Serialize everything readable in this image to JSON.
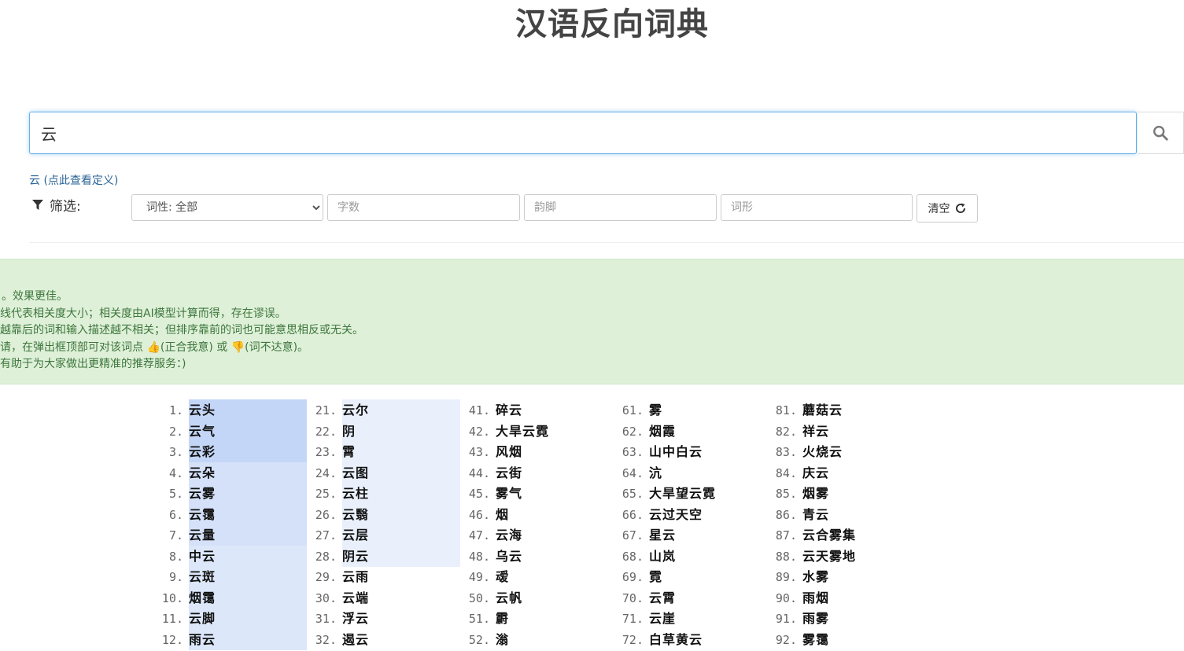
{
  "header": {
    "title": "汉语反向词典"
  },
  "search": {
    "value": "云"
  },
  "definition_link": "云 (点此查看定义)",
  "filters": {
    "label": "筛选:",
    "pos_select": "词性: 全部",
    "char_count_placeholder": "字数",
    "rhyme_placeholder": "韵脚",
    "shape_placeholder": "词形",
    "clear_label": "清空"
  },
  "notice": {
    "lines": [
      "。效果更佳。",
      "线代表相关度大小；相关度由AI模型计算而得，存在谬误。",
      "越靠后的词和输入描述越不相关；但排序靠前的词也可能意思相反或无关。",
      "请，在弹出框顶部可对该词点 👍(正合我意) 或 👎(词不达意)。",
      "有助于为大家做出更精准的推荐服务：)"
    ]
  },
  "colors": {
    "highlight_strong": "#c3d6f7",
    "highlight_mid": "#dce7fa",
    "highlight_light": "#e9f0fc"
  },
  "results": [
    {
      "n": "1.",
      "w": "云头",
      "rel": 1.0
    },
    {
      "n": "2.",
      "w": "云气",
      "rel": 0.98
    },
    {
      "n": "3.",
      "w": "云彩",
      "rel": 0.96
    },
    {
      "n": "4.",
      "w": "云朵",
      "rel": 0.9
    },
    {
      "n": "5.",
      "w": "云雾",
      "rel": 0.88
    },
    {
      "n": "6.",
      "w": "云霭",
      "rel": 0.86
    },
    {
      "n": "7.",
      "w": "云量",
      "rel": 0.84
    },
    {
      "n": "8.",
      "w": "中云",
      "rel": 0.8
    },
    {
      "n": "9.",
      "w": "云斑",
      "rel": 0.78
    },
    {
      "n": "10.",
      "w": "烟霭",
      "rel": 0.76
    },
    {
      "n": "11.",
      "w": "云脚",
      "rel": 0.74
    },
    {
      "n": "12.",
      "w": "雨云",
      "rel": 0.72
    },
    {
      "n": "21.",
      "w": "云尔",
      "rel": 0.5
    },
    {
      "n": "22.",
      "w": "阴",
      "rel": 0.5
    },
    {
      "n": "23.",
      "w": "霄",
      "rel": 0.5
    },
    {
      "n": "24.",
      "w": "云图",
      "rel": 0.5
    },
    {
      "n": "25.",
      "w": "云柱",
      "rel": 0.5
    },
    {
      "n": "26.",
      "w": "云翳",
      "rel": 0.5
    },
    {
      "n": "27.",
      "w": "云层",
      "rel": 0.5
    },
    {
      "n": "28.",
      "w": "阴云",
      "rel": 0.5
    },
    {
      "n": "29.",
      "w": "云雨",
      "rel": 0
    },
    {
      "n": "30.",
      "w": "云端",
      "rel": 0
    },
    {
      "n": "31.",
      "w": "浮云",
      "rel": 0
    },
    {
      "n": "32.",
      "w": "遏云",
      "rel": 0
    },
    {
      "n": "41.",
      "w": "碎云",
      "rel": 0
    },
    {
      "n": "42.",
      "w": "大旱云霓",
      "rel": 0
    },
    {
      "n": "43.",
      "w": "风烟",
      "rel": 0
    },
    {
      "n": "44.",
      "w": "云街",
      "rel": 0
    },
    {
      "n": "45.",
      "w": "雾气",
      "rel": 0
    },
    {
      "n": "46.",
      "w": "烟",
      "rel": 0
    },
    {
      "n": "47.",
      "w": "云海",
      "rel": 0
    },
    {
      "n": "48.",
      "w": "乌云",
      "rel": 0
    },
    {
      "n": "49.",
      "w": "叆",
      "rel": 0
    },
    {
      "n": "50.",
      "w": "云帆",
      "rel": 0
    },
    {
      "n": "51.",
      "w": "霨",
      "rel": 0
    },
    {
      "n": "52.",
      "w": "滃",
      "rel": 0
    },
    {
      "n": "61.",
      "w": "雾",
      "rel": 0
    },
    {
      "n": "62.",
      "w": "烟霞",
      "rel": 0
    },
    {
      "n": "63.",
      "w": "山中白云",
      "rel": 0
    },
    {
      "n": "64.",
      "w": "沆",
      "rel": 0
    },
    {
      "n": "65.",
      "w": "大旱望云霓",
      "rel": 0
    },
    {
      "n": "66.",
      "w": "云过天空",
      "rel": 0
    },
    {
      "n": "67.",
      "w": "星云",
      "rel": 0
    },
    {
      "n": "68.",
      "w": "山岚",
      "rel": 0
    },
    {
      "n": "69.",
      "w": "霓",
      "rel": 0
    },
    {
      "n": "70.",
      "w": "云霄",
      "rel": 0
    },
    {
      "n": "71.",
      "w": "云崖",
      "rel": 0
    },
    {
      "n": "72.",
      "w": "白草黄云",
      "rel": 0
    },
    {
      "n": "81.",
      "w": "蘑菇云",
      "rel": 0
    },
    {
      "n": "82.",
      "w": "祥云",
      "rel": 0
    },
    {
      "n": "83.",
      "w": "火烧云",
      "rel": 0
    },
    {
      "n": "84.",
      "w": "庆云",
      "rel": 0
    },
    {
      "n": "85.",
      "w": "烟雾",
      "rel": 0
    },
    {
      "n": "86.",
      "w": "青云",
      "rel": 0
    },
    {
      "n": "87.",
      "w": "云合雾集",
      "rel": 0
    },
    {
      "n": "88.",
      "w": "云天雾地",
      "rel": 0
    },
    {
      "n": "89.",
      "w": "水雾",
      "rel": 0
    },
    {
      "n": "90.",
      "w": "雨烟",
      "rel": 0
    },
    {
      "n": "91.",
      "w": "雨雾",
      "rel": 0
    },
    {
      "n": "92.",
      "w": "雾霭",
      "rel": 0
    }
  ]
}
